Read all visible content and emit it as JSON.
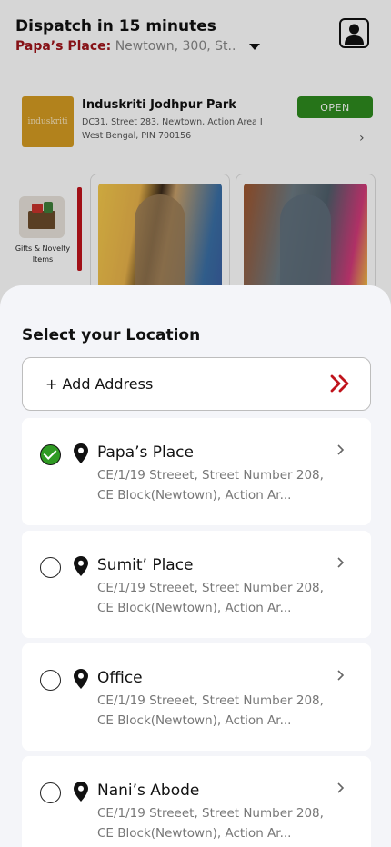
{
  "header": {
    "dispatch_title": "Dispatch in 15 minutes",
    "location_name": "Papa’s Place:",
    "location_address": "Newtown, 300, St..",
    "profile_icon": "user-icon"
  },
  "store": {
    "logo_text": "induskriti",
    "name": "Induskriti Jodhpur Park",
    "address": "DC31, Street 283, Newtown, Action Area I West Bengal, PIN 700156",
    "status": "OPEN",
    "status_color": "#2e8b1e"
  },
  "category": {
    "label": "Gifts & Novelty Items",
    "accent": "#c0141c"
  },
  "sheet": {
    "title": "Select your Location",
    "add_address_label": "+ Add Address",
    "add_icon": "double-chevron-right-icon",
    "accent": "#c0141c"
  },
  "addresses": [
    {
      "name": "Papa’s Place",
      "line1": "CE/1/19 Streeet, Street Number 208,",
      "line2": "CE Block(Newtown), Action Ar...",
      "selected": true
    },
    {
      "name": "Sumit’ Place",
      "line1": "CE/1/19 Streeet, Street Number 208,",
      "line2": "CE Block(Newtown), Action Ar...",
      "selected": false
    },
    {
      "name": "Office",
      "line1": "CE/1/19 Streeet, Street Number 208,",
      "line2": "CE Block(Newtown), Action Ar...",
      "selected": false
    },
    {
      "name": "Nani’s Abode",
      "line1": "CE/1/19 Streeet, Street Number 208,",
      "line2": "CE Block(Newtown), Action Ar...",
      "selected": false
    }
  ],
  "selected_color": "#2f9a23"
}
